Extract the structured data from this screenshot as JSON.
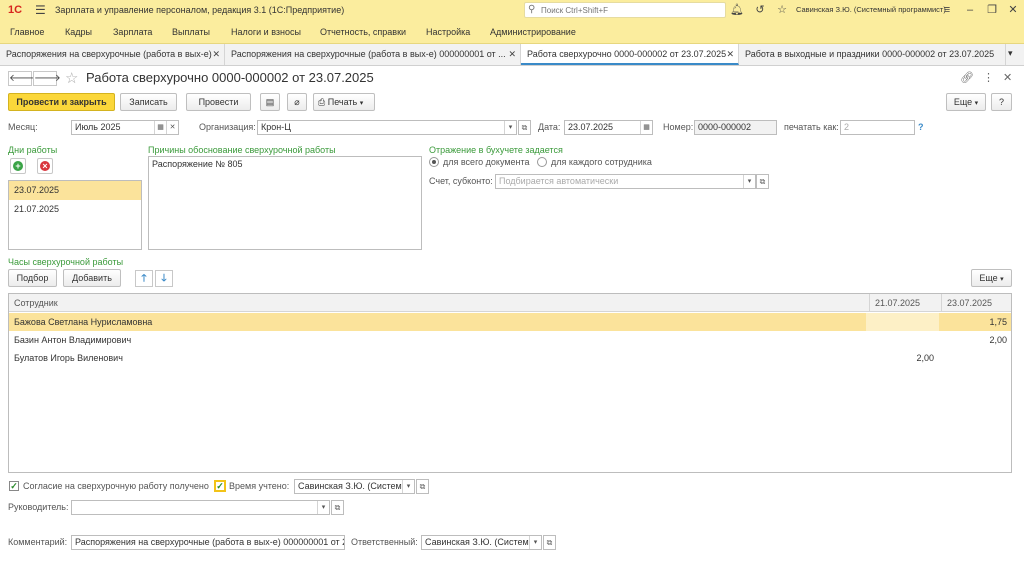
{
  "app": {
    "title": "Зарплата и управление персоналом, редакция 3.1  (1С:Предприятие)",
    "search_placeholder": "Поиск Ctrl+Shift+F",
    "user": "Савинская З.Ю. (Системный программист)"
  },
  "menu": [
    "Главное",
    "Кадры",
    "Зарплата",
    "Выплаты",
    "Налоги и взносы",
    "Отчетность, справки",
    "Настройка",
    "Администрирование"
  ],
  "tabs": [
    {
      "label": "Распоряжения на сверхурочные (работа в вых-е)"
    },
    {
      "label": "Распоряжения на сверхурочные (работа в вых-е) 000000001 от ..."
    },
    {
      "label": "Работа сверхурочно 0000-000002 от 23.07.2025"
    },
    {
      "label": "Работа в выходные и праздники 0000-000002 от 23.07.2025"
    }
  ],
  "form": {
    "title": "Работа сверхурочно 0000-000002 от 23.07.2025",
    "buttons": {
      "post_close": "Провести и закрыть",
      "save": "Записать",
      "post": "Провести",
      "print": "Печать",
      "more": "Еще",
      "help": "?"
    },
    "month_label": "Месяц:",
    "month_value": "Июль 2025",
    "org_label": "Организация:",
    "org_value": "Крон-Ц",
    "date_label": "Дата:",
    "date_value": "23.07.2025",
    "number_label": "Номер:",
    "number_value": "0000-000002",
    "print_as_label": "печатать как:",
    "print_as_placeholder": "2",
    "help_q": "?"
  },
  "work_days": {
    "title": "Дни работы",
    "items": [
      "23.07.2025",
      "21.07.2025"
    ]
  },
  "reasons": {
    "title": "Причины обоснование сверхурочной работы",
    "text": "Распоряжение № 805"
  },
  "accounting": {
    "title": "Отражение в бухучете задается",
    "option_all": "для всего документа",
    "option_each": "для каждого сотрудника",
    "account_label": "Счет, субконто:",
    "account_placeholder": "Подбирается автоматически"
  },
  "hours": {
    "title": "Часы сверхурочной работы",
    "select_btn": "Подбор",
    "add_btn": "Добавить",
    "more_btn": "Еще",
    "columns": [
      "Сотрудник",
      "21.07.2025",
      "23.07.2025"
    ],
    "rows": [
      {
        "name": "Бажова Светлана Нурисламовна",
        "d1": "",
        "d2": "1,75"
      },
      {
        "name": "Базин Антон Владимирович",
        "d1": "",
        "d2": "2,00"
      },
      {
        "name": "Булатов Игорь Виленович",
        "d1": "2,00",
        "d2": ""
      }
    ]
  },
  "footer": {
    "consent_label": "Согласие на сверхурочную работу получено",
    "time_counted_label": "Время учтено:",
    "time_counted_value": "Савинская З.Ю. (Систем",
    "head_label": "Руководитель:",
    "head_value": "",
    "comment_label": "Комментарий:",
    "comment_value": "Распоряжения на сверхурочные (работа в вых-е) 000000001 от 23",
    "responsible_label": "Ответственный:",
    "responsible_value": "Савинская З.Ю. (Систем"
  }
}
